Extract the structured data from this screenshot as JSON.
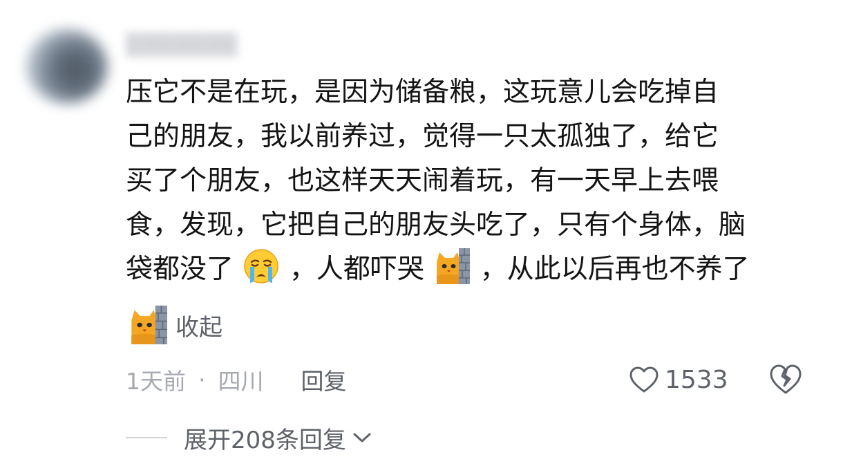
{
  "comment": {
    "lines": [
      "压它不是在玩，是因为储备粮，这玩意儿会吃掉自",
      "己的朋友，我以前养过，觉得一只太孤独了，给它",
      "买了个朋友，也这样天天闹着玩，有一天早上去喂",
      "食，发现，它把自己的朋友头吃了，只有个身体，脑"
    ],
    "last_line": {
      "part1": "袋都没了",
      "part2": "，人都吓哭",
      "part3": "，从此以后再也不养了"
    },
    "collapse_label": "收起"
  },
  "meta": {
    "time": "1天前",
    "dot": "·",
    "location": "四川",
    "reply_label": "回复",
    "like_count": "1533"
  },
  "thread": {
    "expand_label": "展开208条回复"
  },
  "icons": {
    "crying": "crying-face-emoji",
    "cat": "cat-behind-wall-emoji",
    "heart": "heart-outline-icon",
    "broken_heart": "broken-heart-icon",
    "chevron": "chevron-down-icon"
  },
  "colors": {
    "text": "#141414",
    "secondary": "#5d6169",
    "muted": "#a6a9b0"
  }
}
